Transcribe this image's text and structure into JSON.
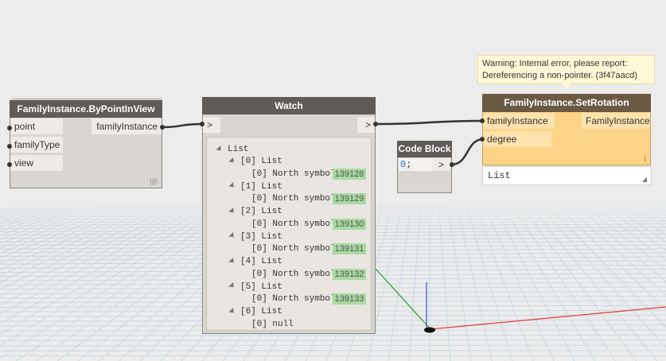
{
  "nodes": {
    "by_point": {
      "title": "FamilyInstance.ByPointInView",
      "inputs": [
        "point",
        "familyType",
        "view"
      ],
      "output": "familyInstance",
      "footer": "|||\\"
    },
    "watch": {
      "title": "Watch",
      "in_arrow": ">",
      "out_arrow": ">",
      "root": "List",
      "groups": [
        {
          "label": "[0] List",
          "item": "[0] North symbol",
          "value": "139128"
        },
        {
          "label": "[1] List",
          "item": "[0] North symbol",
          "value": "139129"
        },
        {
          "label": "[2] List",
          "item": "[0] North symbol",
          "value": "139130"
        },
        {
          "label": "[3] List",
          "item": "[0] North symbol",
          "value": "139131"
        },
        {
          "label": "[4] List",
          "item": "[0] North symbol",
          "value": "139132"
        },
        {
          "label": "[5] List",
          "item": "[0] North symbol",
          "value": "139133"
        },
        {
          "label": "[6] List",
          "item": "[0] null",
          "value": ""
        }
      ]
    },
    "code_block": {
      "title": "Code Block",
      "code_number": "0",
      "code_rest": ";",
      "out_arrow": ">"
    },
    "set_rotation": {
      "title": "FamilyInstance.SetRotation",
      "inputs": [
        "familyInstance",
        "degree"
      ],
      "output": "FamilyInstance",
      "warning_line1": "Warning: Internal error, please report:",
      "warning_line2": "Dereferencing a non-pointer. (3f47aacd)",
      "preview": "List",
      "footer": "|"
    }
  },
  "colors": {
    "background": "#ececec",
    "header": "#5e5b58",
    "warning_body": "#fdd487",
    "warning_header": "#6b5a43",
    "tooltip": "#fff8d6",
    "value_badge": "#a8d9a0",
    "grid": "#c9d9e2",
    "axis_x": "#e23b3b",
    "axis_y": "#2a9a2a",
    "axis_z": "#3a4fd6"
  }
}
